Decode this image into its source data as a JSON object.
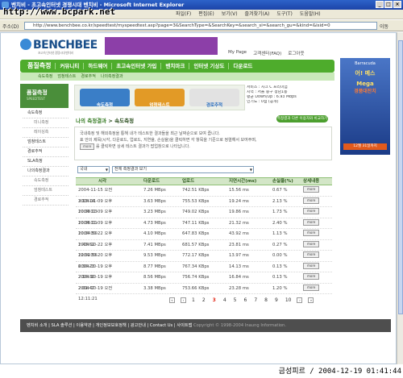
{
  "window": {
    "title": "벤치비 - 초고속인터넷 경쟁시대 벤치비 - Microsoft Internet Explorer",
    "controls": [
      "_",
      "□",
      "×"
    ]
  },
  "watermark": "http://www.bcpark.net",
  "menu": [
    "파일(F)",
    "편집(E)",
    "보기(V)",
    "즐겨찾기(A)",
    "도구(T)",
    "도움말(H)"
  ],
  "address": {
    "label": "주소(D)",
    "url": "http://www.benchbee.co.kr/speedtest/myspeedtest.asp?page=3&SearchType=&SearchKey=&search_si=&search_gu=&kind=&isid=0",
    "go": "이동"
  },
  "site": {
    "logo": "BENCHBEE",
    "tagline": "초고속 인터넷 경쟁시대 벤치비",
    "top_links": [
      "My Page",
      "고객센터(FAQ)",
      "로그아웃"
    ],
    "nav": [
      "품질측정",
      "커뮤니티",
      "하드웨어",
      "초고속인터넷 가입",
      "벤치마크",
      "인터넷 기상도",
      "다운로드"
    ],
    "subnav": [
      "속도측정",
      "엄청테스트",
      "경로추적",
      "나의측정결과"
    ],
    "sidebar_title": "품질측정",
    "sidebar_title_en": "SPEEDTEST",
    "sidebar": [
      {
        "label": "속도측정",
        "sub": false
      },
      {
        "label": "미니측정",
        "sub": true
      },
      {
        "label": "레이싱측",
        "sub": true
      },
      {
        "label": "엄청테스트",
        "sub": false
      },
      {
        "label": "경로추적",
        "sub": false
      },
      {
        "label": "SLA측정",
        "sub": false
      },
      {
        "label": "나의측정결과",
        "sub": false
      },
      {
        "label": "속도측정",
        "sub": true
      },
      {
        "label": "엄청테스트",
        "sub": true
      },
      {
        "label": "경로추적",
        "sub": true
      }
    ],
    "promo_buttons": [
      "속도측정",
      "엄청테스트",
      "경로추적"
    ],
    "user_info": [
      "서비스 : 사크 C 프리미엄",
      "지역 : 서울 중구 정남1동",
      "평균 Down/Up : 6.93 Mbps",
      "인기도 : 0점 (공개)"
    ],
    "ad": {
      "brand": "Barracuda",
      "line1": "어! 메스",
      "line2": "Mega",
      "line3": "경품대잔치",
      "date": "12월 31일까지"
    }
  },
  "section": {
    "title": "나의 측정결과",
    "breadcrumb": "> 속도측정",
    "compare_button": "측정결과 다른 이용자와 비교하기"
  },
  "description": {
    "line1": "국내측정 및 해외측정을 통해 내가 테스트한 결과들을 최근 날짜순으로 보여 줍니다.",
    "line2": "표 안의 제목(시각, 다운로드, 업로드, 지연율, 손실율)을 클릭하면 각 항목을 기준으로 정렬해서 보여주며,",
    "more_label": "more",
    "line3": "를 클릭하면 상세 테스트 결과가 팝업창으로 나타납니다."
  },
  "filters": {
    "region": "국내",
    "period": "전체 측정결과 보기"
  },
  "table": {
    "headers": [
      "시각",
      "다운로드",
      "업로드",
      "지연시간(ms)",
      "손실율(%)",
      "상세내용"
    ],
    "rows": [
      [
        "2004-11-15 오전 3:13:14",
        "7.26 MBps",
        "742.51 KBps",
        "15.56 ms",
        "0.67 %",
        "more"
      ],
      [
        "2004-11-09 오후 10:38:13",
        "3.63 MBps",
        "755.53 KBps",
        "19.24 ms",
        "2.13 %",
        "more"
      ],
      [
        "2004-11-09 오후 10:36:11",
        "3.23 MBps",
        "749.02 KBps",
        "19.86 ms",
        "1.73 %",
        "more"
      ],
      [
        "2004-11-09 오후 10:34:50",
        "4.73 MBps",
        "747.11 KBps",
        "21.32 ms",
        "2.40 %",
        "more"
      ],
      [
        "2004-10-22 오후 1:43:52",
        "4.10 MBps",
        "647.83 KBps",
        "43.92 ms",
        "1.13 %",
        "more"
      ],
      [
        "2004-10-22 오후 12:52:56",
        "7.41 MBps",
        "681.57 KBps",
        "23.81 ms",
        "0.27 %",
        "more"
      ],
      [
        "2004-10-20 오후 6:36:23",
        "9.53 MBps",
        "772.17 KBps",
        "13.97 ms",
        "0.00 %",
        "more"
      ],
      [
        "2004-10-19 오후 2:16:30",
        "8.77 MBps",
        "767.34 KBps",
        "14.13 ms",
        "0.13 %",
        "more"
      ],
      [
        "2004-10-19 오후 2:01:47",
        "8.56 MBps",
        "756.74 KBps",
        "16.84 ms",
        "0.13 %",
        "more"
      ],
      [
        "2004-10-19 오전 12:11:21",
        "3.38 MBps",
        "753.66 KBps",
        "23.28 ms",
        "1.20 %",
        "more"
      ]
    ]
  },
  "pagination": {
    "pages": [
      "1",
      "2",
      "3",
      "4",
      "5",
      "6",
      "7",
      "8",
      "9",
      "10"
    ],
    "current": "3"
  },
  "footer": {
    "links": "벤치비 소개 | SLA 솔루션 | 이용약관 | 개인정보보호정책 | 광고안내 | Contact Us | 사이트맵",
    "copyright": "Copyright © 1998-2004 Inaung Information."
  },
  "status": {
    "stamp": "금성피르 / 2004-12-19 01:41:44"
  }
}
